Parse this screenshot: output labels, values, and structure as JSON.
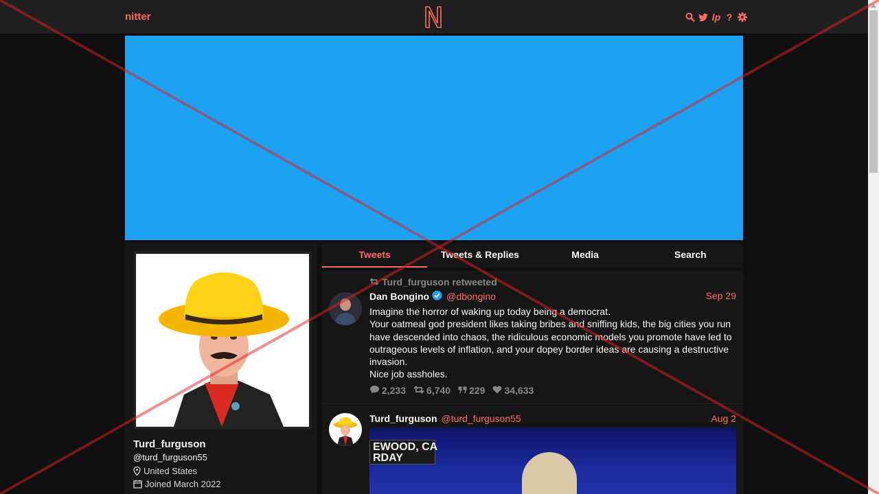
{
  "nav": {
    "brand": "nitter",
    "logo_letter": "N",
    "icons": [
      "search-icon",
      "twitter-bird-icon",
      "lp-icon",
      "help-icon",
      "gear-icon"
    ],
    "lp_label": "lp",
    "help_label": "?"
  },
  "colors": {
    "accent": "#ff6c60",
    "banner": "#1da1f2",
    "background": "#0f0f0f",
    "panel": "#161616",
    "nav_bg": "#1f1f1f",
    "verified": "#1da1f2"
  },
  "profile": {
    "display_name": "Turd_furguson",
    "username": "@turd_furguson55",
    "location": "United States",
    "joined": "Joined March 2022"
  },
  "tabs": [
    {
      "label": "Tweets",
      "active": true
    },
    {
      "label": "Tweets & Replies",
      "active": false
    },
    {
      "label": "Media",
      "active": false
    },
    {
      "label": "Search",
      "active": false
    }
  ],
  "tweets": [
    {
      "retweet_label": "Turd_furguson retweeted",
      "name": "Dan Bongino",
      "verified": true,
      "handle": "@dbongino",
      "date": "Sep 29",
      "lines": [
        "Imagine the horror of waking up today being a democrat.",
        "Your oatmeal god president likes taking bribes and sniffing kids, the big cities you run have descended into chaos, the ridiculous economic models you promote have led to outrageous levels of inflation, and your dopey border ideas are causing a destructive invasion.",
        "Nice job assholes."
      ],
      "stats": {
        "replies": "2,233",
        "retweets": "6,740",
        "quotes": "229",
        "likes": "34,633"
      }
    },
    {
      "name": "Turd_furguson",
      "handle": "@turd_furguson55",
      "date": "Aug 2",
      "media_caption": "EWOOD, CA\nRDAY"
    }
  ]
}
